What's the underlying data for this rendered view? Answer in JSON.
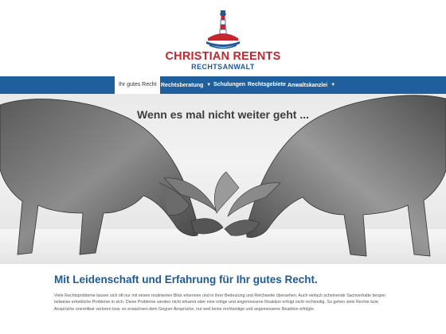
{
  "brand": {
    "name": "CHRISTIAN REENTS",
    "subtitle": "RECHTSANWALT",
    "logo_icon": "lighthouse-icon",
    "colors": {
      "red": "#c4262e",
      "blue": "#1c5a9c"
    }
  },
  "nav": {
    "items": [
      {
        "label": "Ihr gutes Recht",
        "active": true,
        "dropdown": false
      },
      {
        "label": "Rechtsberatung",
        "active": false,
        "dropdown": true
      },
      {
        "label": "Schulungen",
        "active": false,
        "dropdown": false
      },
      {
        "label": "Rechtsgebiete",
        "active": false,
        "dropdown": false
      },
      {
        "label": "Anwaltskanzlei",
        "active": false,
        "dropdown": true
      }
    ],
    "background": "#1f5f9e"
  },
  "hero": {
    "tagline": "Wenn es mal nicht weiter geht ..."
  },
  "main": {
    "headline": "Mit Leidenschaft und Erfahrung für Ihr gutes Recht.",
    "paragraph": "Viele Rechtsprobleme lassen sich oft nur mit einem routinierten Blick erkennen und in ihrer Bedeutung und Reichweite übersehen. Auch einfach scheinende Sachverhalte bergen teilweise erhebliche Probleme in sich. Diese Probleme werden nicht erkannt oder eine nötige und angemessene Reaktion erfolgt nicht rechtzeitig. So gehen viele Rechte bzw. Ansprüche unerettbar verloren bzw. es erwachsen dem Gegner Ansprüche, nur weil keine rechtzeitige und angemessene Reaktion erfolgte."
  }
}
